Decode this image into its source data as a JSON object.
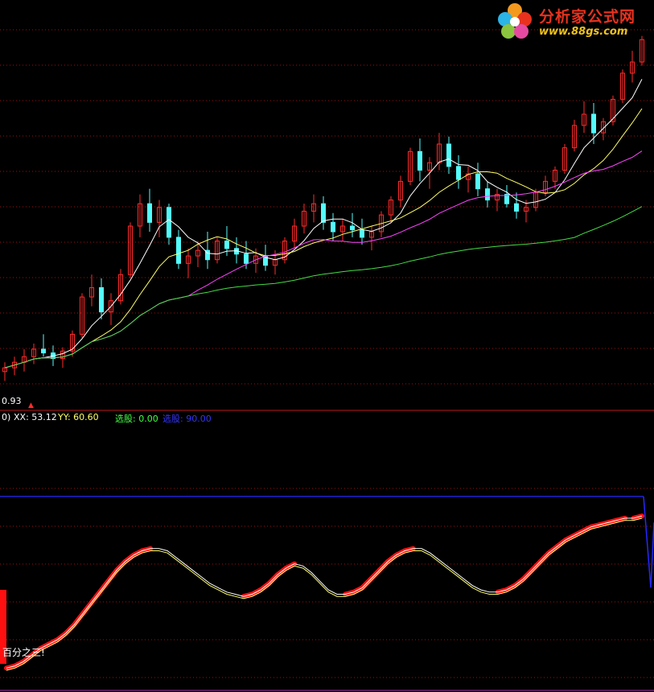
{
  "logo": {
    "title": "分析家公式网",
    "url": "www.88gs.com"
  },
  "main_panel": {
    "low_price_label": "0.93"
  },
  "indicator_panel": {
    "header_prefix": "0)",
    "xx_label": "XX: 53.12",
    "yy_label": "YY: 60.60",
    "select_label": "选股: 0.00",
    "select2_label": "选股: 90.00",
    "bottom_text": "百分之三!"
  },
  "colors": {
    "background": "#000000",
    "up_candle": "#ff2b2b",
    "down_candle": "#54fcfc",
    "ma_short": "#ffffff",
    "ma_mid": "#ffff66",
    "ma_long": "#ff44ff",
    "ma_longest": "#44dd44",
    "gridline": "#a01010",
    "divider": "#c01818",
    "xx_color": "#ffffff",
    "yy_color": "#ffff66",
    "select_color": "#44ff44",
    "select2_color": "#3333ff",
    "indicator_fill": "#ff1010",
    "ceiling_line": "#2828ff"
  },
  "chart_data": [
    {
      "type": "candlestick",
      "candles": [
        [
          1.0,
          1.05,
          0.95,
          1.02
        ],
        [
          1.02,
          1.08,
          0.98,
          1.05
        ],
        [
          1.05,
          1.12,
          1.0,
          1.08
        ],
        [
          1.08,
          1.15,
          1.04,
          1.12
        ],
        [
          1.12,
          1.2,
          1.08,
          1.1
        ],
        [
          1.1,
          1.14,
          1.03,
          1.07
        ],
        [
          1.07,
          1.13,
          1.02,
          1.11
        ],
        [
          1.11,
          1.22,
          1.08,
          1.2
        ],
        [
          1.2,
          1.42,
          1.18,
          1.4
        ],
        [
          1.4,
          1.52,
          1.35,
          1.45
        ],
        [
          1.45,
          1.5,
          1.28,
          1.32
        ],
        [
          1.32,
          1.42,
          1.25,
          1.38
        ],
        [
          1.38,
          1.55,
          1.36,
          1.52
        ],
        [
          1.52,
          1.8,
          1.5,
          1.78
        ],
        [
          1.78,
          1.95,
          1.72,
          1.9
        ],
        [
          1.9,
          1.98,
          1.75,
          1.8
        ],
        [
          1.8,
          1.92,
          1.72,
          1.88
        ],
        [
          1.88,
          1.9,
          1.68,
          1.72
        ],
        [
          1.72,
          1.76,
          1.55,
          1.58
        ],
        [
          1.58,
          1.66,
          1.5,
          1.62
        ],
        [
          1.62,
          1.7,
          1.56,
          1.65
        ],
        [
          1.65,
          1.75,
          1.55,
          1.6
        ],
        [
          1.6,
          1.72,
          1.58,
          1.7
        ],
        [
          1.7,
          1.78,
          1.62,
          1.66
        ],
        [
          1.66,
          1.72,
          1.58,
          1.63
        ],
        [
          1.63,
          1.7,
          1.55,
          1.58
        ],
        [
          1.58,
          1.66,
          1.53,
          1.62
        ],
        [
          1.62,
          1.68,
          1.54,
          1.57
        ],
        [
          1.57,
          1.65,
          1.52,
          1.6
        ],
        [
          1.6,
          1.72,
          1.58,
          1.7
        ],
        [
          1.7,
          1.82,
          1.66,
          1.78
        ],
        [
          1.78,
          1.9,
          1.74,
          1.86
        ],
        [
          1.86,
          1.95,
          1.8,
          1.9
        ],
        [
          1.9,
          1.94,
          1.76,
          1.8
        ],
        [
          1.8,
          1.85,
          1.7,
          1.75
        ],
        [
          1.75,
          1.82,
          1.7,
          1.78
        ],
        [
          1.78,
          1.85,
          1.72,
          1.76
        ],
        [
          1.76,
          1.82,
          1.68,
          1.72
        ],
        [
          1.72,
          1.78,
          1.65,
          1.75
        ],
        [
          1.75,
          1.86,
          1.72,
          1.84
        ],
        [
          1.84,
          1.94,
          1.8,
          1.92
        ],
        [
          1.92,
          2.05,
          1.88,
          2.02
        ],
        [
          2.02,
          2.2,
          2.0,
          2.18
        ],
        [
          2.18,
          2.25,
          2.02,
          2.08
        ],
        [
          2.08,
          2.15,
          1.98,
          2.12
        ],
        [
          2.12,
          2.28,
          2.08,
          2.22
        ],
        [
          2.22,
          2.26,
          2.06,
          2.1
        ],
        [
          2.1,
          2.16,
          1.98,
          2.03
        ],
        [
          2.03,
          2.1,
          1.96,
          2.06
        ],
        [
          2.06,
          2.12,
          1.94,
          1.98
        ],
        [
          1.98,
          2.02,
          1.88,
          1.92
        ],
        [
          1.92,
          1.98,
          1.86,
          1.95
        ],
        [
          1.95,
          2.0,
          1.88,
          1.9
        ],
        [
          1.9,
          1.96,
          1.82,
          1.86
        ],
        [
          1.86,
          1.92,
          1.8,
          1.88
        ],
        [
          1.88,
          1.98,
          1.86,
          1.96
        ],
        [
          1.96,
          2.05,
          1.94,
          2.02
        ],
        [
          2.02,
          2.1,
          1.98,
          2.08
        ],
        [
          2.08,
          2.22,
          2.06,
          2.2
        ],
        [
          2.2,
          2.35,
          2.18,
          2.32
        ],
        [
          2.32,
          2.45,
          2.28,
          2.38
        ],
        [
          2.38,
          2.44,
          2.22,
          2.28
        ],
        [
          2.28,
          2.36,
          2.24,
          2.34
        ],
        [
          2.34,
          2.48,
          2.32,
          2.46
        ],
        [
          2.46,
          2.62,
          2.44,
          2.6
        ],
        [
          2.6,
          2.72,
          2.55,
          2.66
        ],
        [
          2.66,
          2.8,
          2.64,
          2.78
        ]
      ],
      "moving_averages": [
        "MA5",
        "MA10",
        "MA20",
        "MA60"
      ],
      "price_low_label": 0.93
    },
    {
      "type": "line",
      "series": [
        {
          "name": "XX",
          "values": [
            11,
            12,
            14,
            17,
            20,
            22,
            24,
            27,
            31,
            36,
            41,
            46,
            51,
            56,
            60,
            63,
            65,
            66,
            66,
            65,
            62,
            59,
            56,
            53,
            50,
            48,
            46,
            45,
            44,
            45,
            47,
            50,
            54,
            57,
            59,
            58,
            55,
            51,
            47,
            45,
            45,
            46,
            48,
            52,
            56,
            60,
            63,
            65,
            66,
            66,
            64,
            61,
            58,
            55,
            52,
            49,
            47,
            46,
            46,
            47,
            49,
            52,
            56,
            60,
            64,
            67,
            70,
            72,
            74,
            76,
            77,
            78,
            79,
            80,
            80,
            81
          ]
        },
        {
          "name": "YY",
          "values": [
            10,
            11,
            13,
            16,
            19,
            21,
            23,
            26,
            30,
            35,
            40,
            45,
            50,
            55,
            59,
            62,
            64,
            65,
            65,
            64,
            61,
            58,
            55,
            52,
            49,
            47,
            45,
            44,
            43,
            44,
            46,
            49,
            53,
            56,
            58,
            57,
            54,
            50,
            46,
            44,
            44,
            45,
            47,
            51,
            55,
            59,
            62,
            64,
            65,
            65,
            63,
            60,
            57,
            54,
            51,
            48,
            46,
            45,
            45,
            46,
            48,
            51,
            55,
            59,
            63,
            66,
            69,
            71,
            73,
            75,
            76,
            77,
            78,
            79,
            79,
            80
          ]
        }
      ]
    }
  ]
}
